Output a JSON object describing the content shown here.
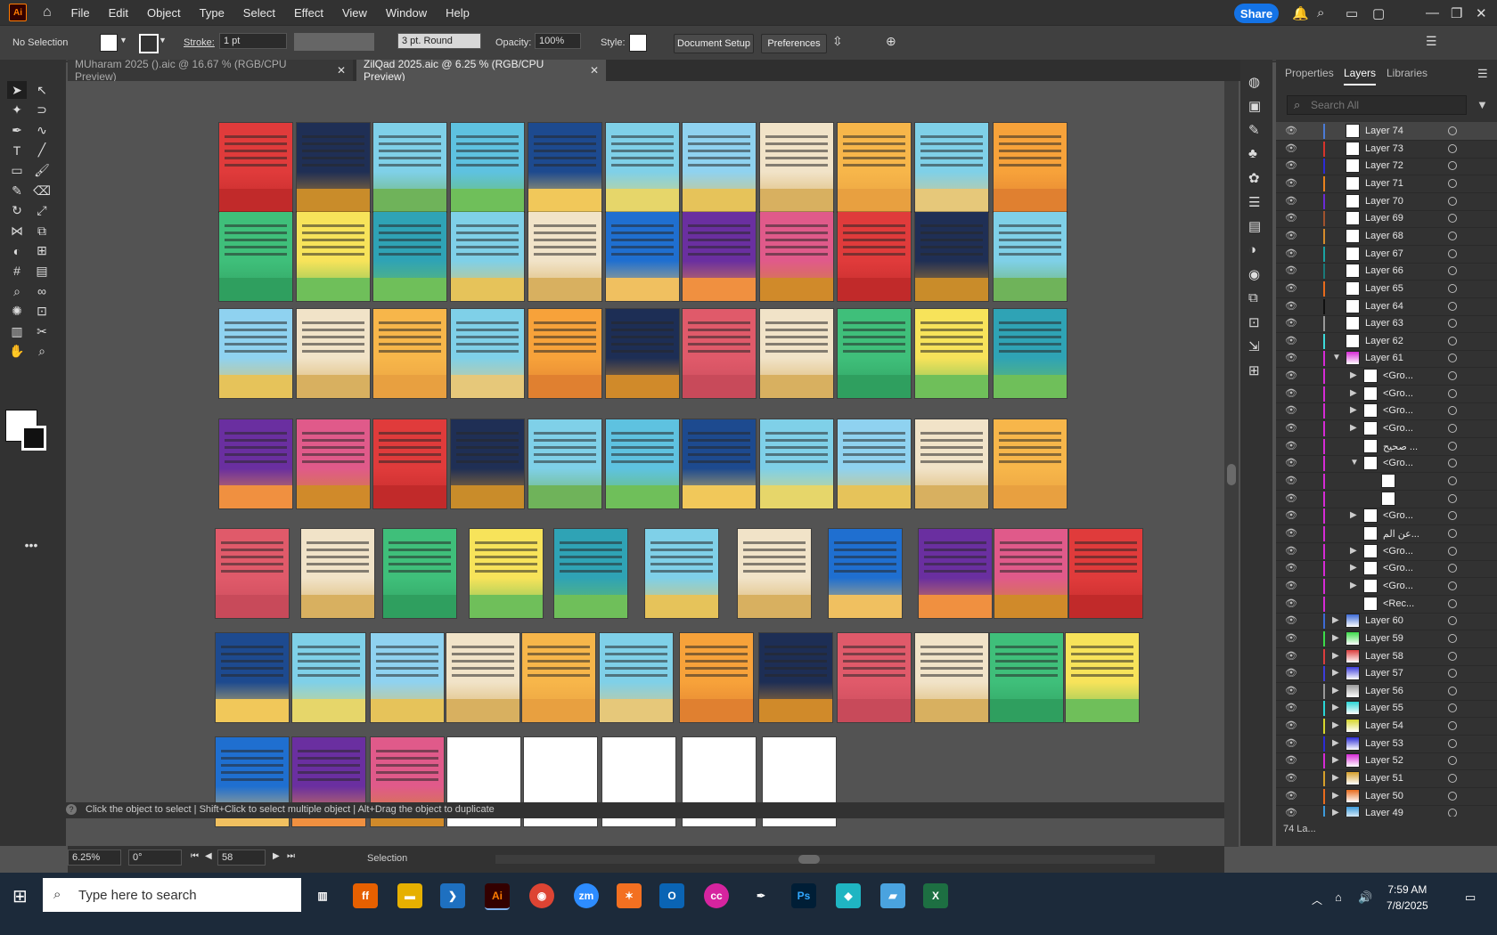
{
  "menubar": {
    "logo": "Ai",
    "items": [
      "File",
      "Edit",
      "Object",
      "Type",
      "Select",
      "Effect",
      "View",
      "Window",
      "Help"
    ],
    "share_label": "Share"
  },
  "control": {
    "selection": "No Selection",
    "stroke_label": "Stroke:",
    "stroke_value": "1 pt",
    "brush": "3 pt. Round",
    "opacity_label": "Opacity:",
    "opacity_value": "100%",
    "style_label": "Style:",
    "doc_setup": "Document Setup",
    "preferences": "Preferences"
  },
  "tabs": [
    {
      "label": "MUharam 2025 ().aic @ 16.67 % (RGB/CPU Preview)"
    },
    {
      "label": "ZilQad 2025.aic @ 6.25 % (RGB/CPU Preview)"
    }
  ],
  "panel": {
    "tabs": [
      "Properties",
      "Layers",
      "Libraries"
    ],
    "search_placeholder": "Search All",
    "layers": [
      {
        "name": "Layer 74",
        "color": "#4b7bd6",
        "level": 0,
        "sel": true
      },
      {
        "name": "Layer 73",
        "color": "#d6342b",
        "level": 0
      },
      {
        "name": "Layer 72",
        "color": "#2b2bd6",
        "level": 0
      },
      {
        "name": "Layer 71",
        "color": "#e8821c",
        "level": 0
      },
      {
        "name": "Layer 70",
        "color": "#6b2bd6",
        "level": 0
      },
      {
        "name": "Layer 69",
        "color": "#a0522d",
        "level": 0
      },
      {
        "name": "Layer 68",
        "color": "#d68b2b",
        "level": 0
      },
      {
        "name": "Layer 67",
        "color": "#1aa3a3",
        "level": 0
      },
      {
        "name": "Layer 66",
        "color": "#1a7a7a",
        "level": 0
      },
      {
        "name": "Layer 65",
        "color": "#e86b1c",
        "level": 0
      },
      {
        "name": "Layer 64",
        "color": "#111111",
        "level": 0
      },
      {
        "name": "Layer 63",
        "color": "#999999",
        "level": 0
      },
      {
        "name": "Layer 62",
        "color": "#3ddbdb",
        "level": 0
      },
      {
        "name": "Layer 61",
        "color": "#d62bd6",
        "level": 0,
        "open": true
      },
      {
        "name": "<Gro...",
        "color": "#d62bd6",
        "level": 1
      },
      {
        "name": "<Gro...",
        "color": "#d62bd6",
        "level": 1
      },
      {
        "name": "<Gro...",
        "color": "#d62bd6",
        "level": 1
      },
      {
        "name": "<Gro...",
        "color": "#d62bd6",
        "level": 1
      },
      {
        "name": "صحیح ...",
        "color": "#d62bd6",
        "level": 1
      },
      {
        "name": "<Gro...",
        "color": "#d62bd6",
        "level": 1,
        "open": true
      },
      {
        "name": "",
        "color": "#d62bd6",
        "level": 2
      },
      {
        "name": "",
        "color": "#d62bd6",
        "level": 2
      },
      {
        "name": "<Gro...",
        "color": "#d62bd6",
        "level": 1
      },
      {
        "name": "عن الم...",
        "color": "#d62bd6",
        "level": 1
      },
      {
        "name": "<Gro...",
        "color": "#d62bd6",
        "level": 1
      },
      {
        "name": "<Gro...",
        "color": "#d62bd6",
        "level": 1
      },
      {
        "name": "<Gro...",
        "color": "#d62bd6",
        "level": 1
      },
      {
        "name": "<Rec...",
        "color": "#d62bd6",
        "level": 1
      },
      {
        "name": "Layer 60",
        "color": "#3d6bd6",
        "level": 0
      },
      {
        "name": "Layer 59",
        "color": "#3ddb4a",
        "level": 0
      },
      {
        "name": "Layer 58",
        "color": "#db3d3d",
        "level": 0
      },
      {
        "name": "Layer 57",
        "color": "#3d3ddb",
        "level": 0
      },
      {
        "name": "Layer 56",
        "color": "#999999",
        "level": 0
      },
      {
        "name": "Layer 55",
        "color": "#2bd6d6",
        "level": 0
      },
      {
        "name": "Layer 54",
        "color": "#d6d62b",
        "level": 0
      },
      {
        "name": "Layer 53",
        "color": "#2b2bd6",
        "level": 0
      },
      {
        "name": "Layer 52",
        "color": "#d62bd6",
        "level": 0
      },
      {
        "name": "Layer 51",
        "color": "#d6a02b",
        "level": 0
      },
      {
        "name": "Layer 50",
        "color": "#e86b1c",
        "level": 0
      },
      {
        "name": "Layer 49",
        "color": "#3d9bdb",
        "level": 0
      }
    ],
    "footer_count": "74 La..."
  },
  "hint": {
    "text": "Click the object to select  |  Shift+Click to select multiple object  |  Alt+Drag the object to duplicate"
  },
  "status": {
    "zoom": "6.25%",
    "rotate": "0°",
    "artboard": "58",
    "tool": "Selection"
  },
  "taskbar": {
    "search_placeholder": "Type here to search",
    "time": "7:59 AM",
    "date": "7/8/2025"
  },
  "colors": {
    "accent": "#1473e6",
    "ui_dark": "#323232",
    "canvas": "#535353"
  }
}
